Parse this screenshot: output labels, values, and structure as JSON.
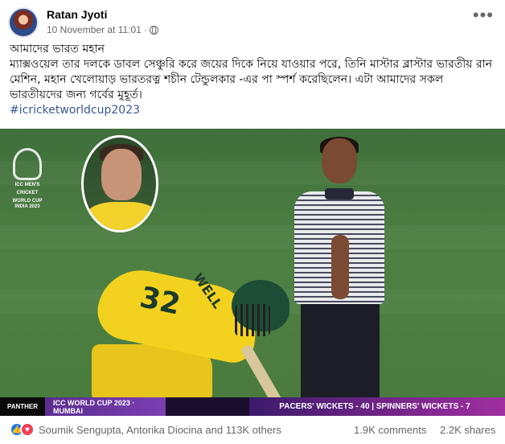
{
  "post": {
    "author": "Ratan Jyoti",
    "timestamp": "10 November at 11:01",
    "separator": "·",
    "privacy_icon": "globe-icon",
    "more_icon": "more-options-icon",
    "more_glyph": "•••",
    "text_lines": [
      "আমাদের ভারত মহান",
      "ম্যাক্সওয়েল তার দলকে ডাবল সেঞ্চুরি করে জয়ের দিকে নিয়ে যাওয়ার পরে, তিনি মাস্টার ব্লাস্টার ভারতীয় রান মেশিন, মহান খেলোয়াড় ভারতরত্ন শচীন টেন্ডুলকার -এর পা স্পর্শ করেছিলেন। এটা আমাদের সকল ভারতীয়দের জন্য গর্বের মুহূর্ত।"
    ],
    "hashtag": "#icricketworldcup2023"
  },
  "photo": {
    "logo_line1": "ICC MEN'S",
    "logo_line2": "CRICKET",
    "logo_line3": "WORLD CUP",
    "logo_line4": "INDIA 2023",
    "jersey_number": "32",
    "jersey_name": "WELL",
    "broadcast_brand": "PANTHER",
    "broadcast_event": "ICC WORLD CUP 2023 · MUMBAI",
    "broadcast_stat": "PACERS' WICKETS - 40 | SPINNERS' WICKETS - 7"
  },
  "footer": {
    "like_glyph": "👍",
    "love_glyph": "♥",
    "reactors": "Soumik Sengupta, Antorika Diocina and 113K others",
    "comments": "1.9K comments",
    "shares": "2.2K shares"
  }
}
